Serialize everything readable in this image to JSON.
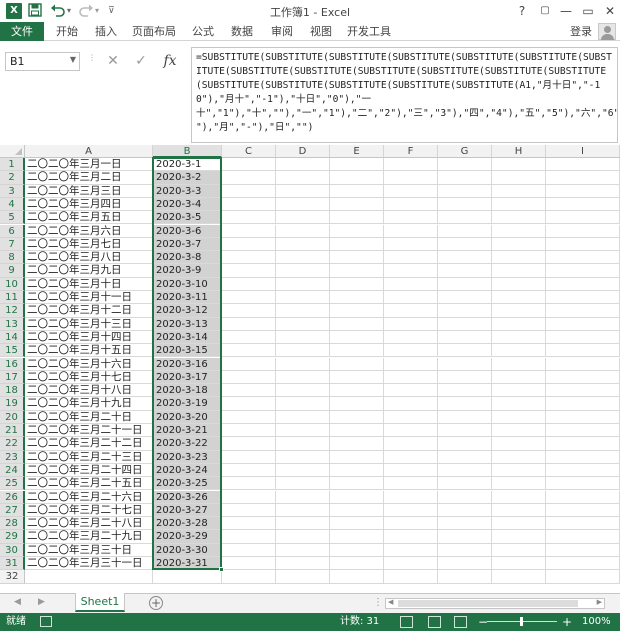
{
  "app": {
    "title": "工作簿1 - Excel",
    "logo": "X",
    "window_buttons": [
      "?",
      "▢",
      "—",
      "▭",
      "✕"
    ]
  },
  "ribbon": {
    "file_tab": "文件",
    "tabs": [
      "开始",
      "插入",
      "页面布局",
      "公式",
      "数据",
      "审阅",
      "视图",
      "开发工具"
    ],
    "login": "登录"
  },
  "formula_bar": {
    "name_box": "B1",
    "fx": "fx",
    "formula": "=SUBSTITUTE(SUBSTITUTE(SUBSTITUTE(SUBSTITUTE(SUBSTITUTE(SUBSTITUTE(SUBSTITUTE(SUBSTITUTE(SUBSTITUTE(SUBSTITUTE(SUBSTITUTE(SUBSTITUTE(SUBSTITUTE(SUBSTITUTE(SUBSTITUTE(SUBSTITUTE(SUBSTITUTE(SUBSTITUTE(A1,\"月十日\",\"-10\"),\"月十\",\"-1\"),\"十日\",\"0\"),\"一十\",\"1\"),\"十\",\"\"),\"一\",\"1\"),\"二\",\"2\"),\"三\",\"3\"),\"四\",\"4\"),\"五\",\"5\"),\"六\",\"6\"),\"七\",\"7\"),\"八\",\"8\"),\"九\",\"9\"),\"〇\",\"0\"),\"年\",\"-\"),\"月\",\"-\"),\"日\",\"\")"
  },
  "grid": {
    "columns": [
      "A",
      "B",
      "C",
      "D",
      "E",
      "F",
      "G",
      "H",
      "I"
    ],
    "selected_column": "B",
    "rows": [
      {
        "n": "1",
        "a": "二〇二〇年三月一日",
        "b": "2020-3-1"
      },
      {
        "n": "2",
        "a": "二〇二〇年三月二日",
        "b": "2020-3-2"
      },
      {
        "n": "3",
        "a": "二〇二〇年三月三日",
        "b": "2020-3-3"
      },
      {
        "n": "4",
        "a": "二〇二〇年三月四日",
        "b": "2020-3-4"
      },
      {
        "n": "5",
        "a": "二〇二〇年三月五日",
        "b": "2020-3-5"
      },
      {
        "n": "6",
        "a": "二〇二〇年三月六日",
        "b": "2020-3-6"
      },
      {
        "n": "7",
        "a": "二〇二〇年三月七日",
        "b": "2020-3-7"
      },
      {
        "n": "8",
        "a": "二〇二〇年三月八日",
        "b": "2020-3-8"
      },
      {
        "n": "9",
        "a": "二〇二〇年三月九日",
        "b": "2020-3-9"
      },
      {
        "n": "10",
        "a": "二〇二〇年三月十日",
        "b": "2020-3-10"
      },
      {
        "n": "11",
        "a": "二〇二〇年三月十一日",
        "b": "2020-3-11"
      },
      {
        "n": "12",
        "a": "二〇二〇年三月十二日",
        "b": "2020-3-12"
      },
      {
        "n": "13",
        "a": "二〇二〇年三月十三日",
        "b": "2020-3-13"
      },
      {
        "n": "14",
        "a": "二〇二〇年三月十四日",
        "b": "2020-3-14"
      },
      {
        "n": "15",
        "a": "二〇二〇年三月十五日",
        "b": "2020-3-15"
      },
      {
        "n": "16",
        "a": "二〇二〇年三月十六日",
        "b": "2020-3-16"
      },
      {
        "n": "17",
        "a": "二〇二〇年三月十七日",
        "b": "2020-3-17"
      },
      {
        "n": "18",
        "a": "二〇二〇年三月十八日",
        "b": "2020-3-18"
      },
      {
        "n": "19",
        "a": "二〇二〇年三月十九日",
        "b": "2020-3-19"
      },
      {
        "n": "20",
        "a": "二〇二〇年三月二十日",
        "b": "2020-3-20"
      },
      {
        "n": "21",
        "a": "二〇二〇年三月二十一日",
        "b": "2020-3-21"
      },
      {
        "n": "22",
        "a": "二〇二〇年三月二十二日",
        "b": "2020-3-22"
      },
      {
        "n": "23",
        "a": "二〇二〇年三月二十三日",
        "b": "2020-3-23"
      },
      {
        "n": "24",
        "a": "二〇二〇年三月二十四日",
        "b": "2020-3-24"
      },
      {
        "n": "25",
        "a": "二〇二〇年三月二十五日",
        "b": "2020-3-25"
      },
      {
        "n": "26",
        "a": "二〇二〇年三月二十六日",
        "b": "2020-3-26"
      },
      {
        "n": "27",
        "a": "二〇二〇年三月二十七日",
        "b": "2020-3-27"
      },
      {
        "n": "28",
        "a": "二〇二〇年三月二十八日",
        "b": "2020-3-28"
      },
      {
        "n": "29",
        "a": "二〇二〇年三月二十九日",
        "b": "2020-3-29"
      },
      {
        "n": "30",
        "a": "二〇二〇年三月三十日",
        "b": "2020-3-30"
      },
      {
        "n": "31",
        "a": "二〇二〇年三月三十一日",
        "b": "2020-3-31"
      },
      {
        "n": "32",
        "a": "",
        "b": ""
      }
    ]
  },
  "sheets": {
    "active": "Sheet1",
    "add": "+"
  },
  "status": {
    "mode": "就绪",
    "count_label": "计数: 31",
    "zoom": "100%",
    "zoom_minus": "−",
    "zoom_plus": "+"
  },
  "colors": {
    "excel_green": "#217346"
  }
}
